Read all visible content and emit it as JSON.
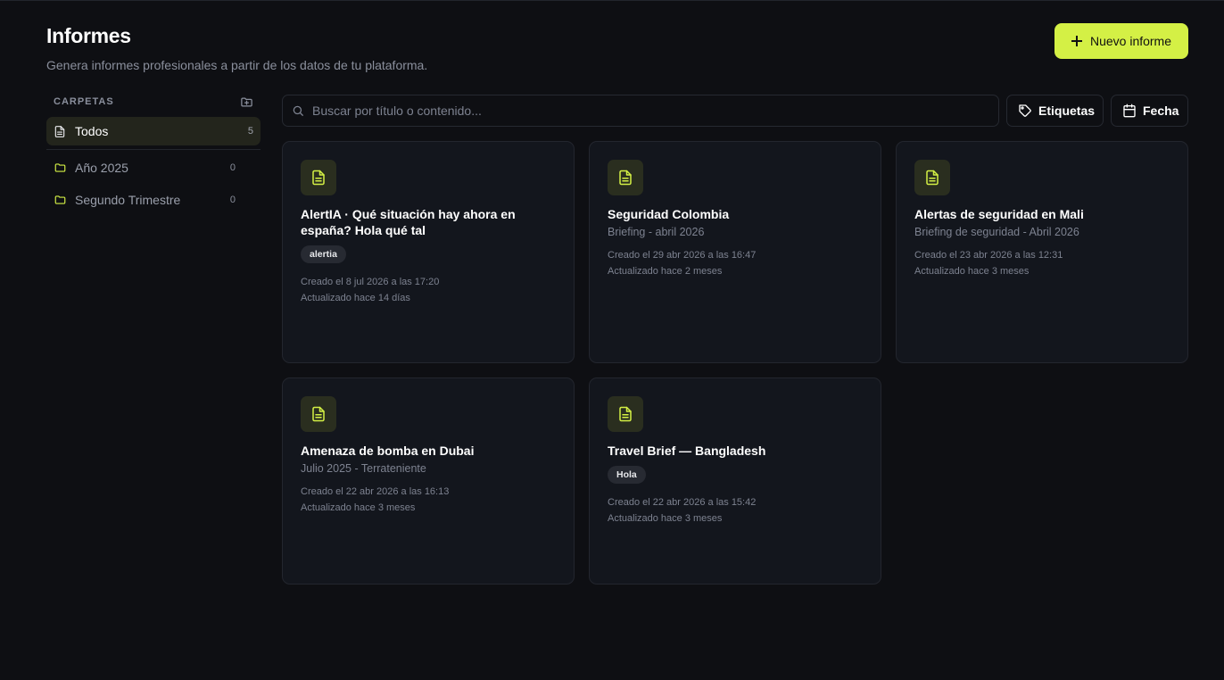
{
  "header": {
    "title": "Informes",
    "subtitle": "Genera informes profesionales a partir de los datos de tu plataforma.",
    "new_button": "Nuevo informe"
  },
  "sidebar": {
    "heading": "CARPETAS",
    "all": {
      "label": "Todos",
      "count": "5"
    },
    "folders": [
      {
        "label": "Año 2025",
        "count": "0"
      },
      {
        "label": "Segundo Trimestre",
        "count": "0"
      }
    ]
  },
  "search": {
    "placeholder": "Buscar por título o contenido..."
  },
  "filters": {
    "tags": "Etiquetas",
    "date": "Fecha"
  },
  "reports": [
    {
      "title": "AlertIA · Qué situación hay ahora en españa? Hola qué tal",
      "tag": "alertia",
      "created": "Creado el 8 jul 2026 a las 17:20",
      "updated": "Actualizado hace 14 días"
    },
    {
      "title": "Seguridad Colombia",
      "subtitle": "Briefing - abril 2026",
      "created": "Creado el 29 abr 2026 a las 16:47",
      "updated": "Actualizado hace 2 meses"
    },
    {
      "title": "Alertas de seguridad en Mali",
      "subtitle": "Briefing de seguridad - Abril 2026",
      "created": "Creado el 23 abr 2026 a las 12:31",
      "updated": "Actualizado hace 3 meses"
    },
    {
      "title": "Amenaza de bomba en Dubai",
      "subtitle": "Julio 2025 - Terrateniente",
      "created": "Creado el 22 abr 2026 a las 16:13",
      "updated": "Actualizado hace 3 meses"
    },
    {
      "title": "Travel Brief — Bangladesh",
      "tag": "Hola",
      "created": "Creado el 22 abr 2026 a las 15:42",
      "updated": "Actualizado hace 3 meses"
    }
  ],
  "colors": {
    "accent": "#d4f045",
    "background": "#0e0f13",
    "card": "#13161d"
  }
}
